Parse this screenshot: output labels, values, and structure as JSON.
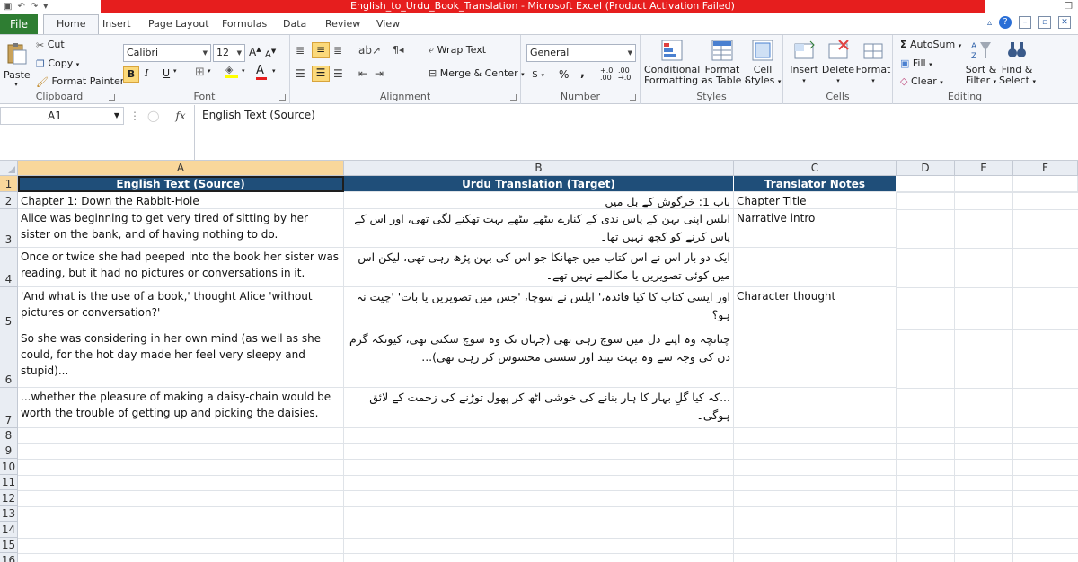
{
  "window": {
    "title": "English_to_Urdu_Book_Translation  -  Microsoft Excel (Product Activation Failed)"
  },
  "tabs": {
    "file": "File",
    "items": [
      "Home",
      "Insert",
      "Page Layout",
      "Formulas",
      "Data",
      "Review",
      "View"
    ],
    "active": "Home"
  },
  "ribbon": {
    "clipboard": {
      "label": "Clipboard",
      "paste": "Paste",
      "cut": "Cut",
      "copy": "Copy",
      "format_painter": "Format Painter"
    },
    "font": {
      "label": "Font",
      "name": "Calibri",
      "size": "12",
      "bold": "B",
      "italic": "I",
      "underline": "U"
    },
    "alignment": {
      "label": "Alignment",
      "wrap_text": "Wrap Text",
      "merge_center": "Merge & Center"
    },
    "number": {
      "label": "Number",
      "format": "General",
      "currency": "$",
      "percent": "%",
      "comma": ","
    },
    "styles": {
      "label": "Styles",
      "conditional": "Conditional",
      "formatting": "Formatting",
      "format_as": "Format",
      "as_table": "as Table",
      "cell": "Cell",
      "cell_styles": "Styles"
    },
    "cells": {
      "label": "Cells",
      "insert": "Insert",
      "delete": "Delete",
      "format": "Format"
    },
    "editing": {
      "label": "Editing",
      "autosum": "AutoSum",
      "fill": "Fill",
      "clear": "Clear",
      "sort": "Sort &",
      "filter": "Filter",
      "find": "Find &",
      "select": "Select"
    }
  },
  "formula_bar": {
    "name_box": "A1",
    "fx": "fx",
    "content": "English Text (Source)"
  },
  "columns": [
    "A",
    "B",
    "C",
    "D",
    "E",
    "F"
  ],
  "rows": [
    "1",
    "2",
    "3",
    "4",
    "5",
    "6",
    "7",
    "8",
    "9",
    "10",
    "11",
    "12",
    "13",
    "14",
    "15",
    "16"
  ],
  "sheet": {
    "headers": [
      "English Text (Source)",
      "Urdu Translation (Target)",
      "Translator Notes"
    ],
    "data": [
      [
        "Chapter 1: Down the Rabbit-Hole",
        "باب 1: خرگوش کے بل میں",
        "Chapter Title"
      ],
      [
        "Alice was beginning to get very tired of sitting by her sister on the bank, and of having nothing to do.",
        "ایلس اپنی بہن کے پاس ندی کے کنارے بیٹھے بیٹھے بہت تھکنے لگی تھی، اور اس کے پاس کرنے کو کچھ نہیں تھا۔",
        "Narrative intro"
      ],
      [
        "Once or twice she had peeped into the book her sister was reading, but it had no pictures or conversations in it.",
        "ایک دو بار اس نے اس کتاب میں جھانکا جو اس کی بہن پڑھ رہی تھی، لیکن اس میں کوئی تصویریں یا مکالمے نہیں تھے۔",
        ""
      ],
      [
        "'And what is the use of a book,' thought Alice 'without pictures or conversation?'",
        "اور ایسی کتاب کا کیا فائدہ،' ایلس نے سوچا، 'جس میں تصویریں یا بات' 'چیت نہ ہو؟",
        "Character thought"
      ],
      [
        "So she was considering in her own mind (as well as she could, for the hot day made her feel very sleepy and stupid)...",
        "چنانچہ وہ اپنے دل میں سوچ رہی تھی (جہاں تک وہ سوچ سکتی تھی، کیونکہ گرم دن کی وجہ سے وہ بہت نیند اور سستی محسوس کر رہی تھی)...",
        ""
      ],
      [
        "...whether the pleasure of making a daisy-chain would be worth the trouble of getting up and picking the daisies.",
        "...کہ کیا گلِ بہار کا ہار بنانے کی خوشی اٹھ کر پھول توڑنے کی زحمت کے لائق ہوگی۔",
        ""
      ]
    ]
  }
}
